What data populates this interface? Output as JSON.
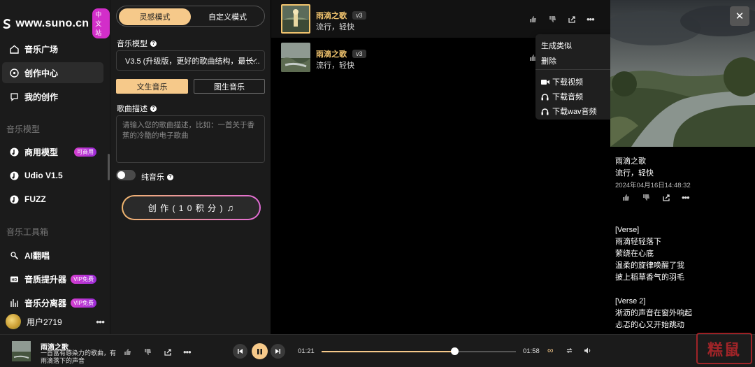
{
  "brand": {
    "name": "www.suno.cn",
    "badge": "中文站"
  },
  "nav": {
    "main": [
      {
        "label": "音乐广场",
        "icon": "home-icon"
      },
      {
        "label": "创作中心",
        "icon": "music-disc-icon"
      },
      {
        "label": "我的创作",
        "icon": "chat-bubble-icon"
      }
    ],
    "section_models": "音乐模型",
    "models": [
      {
        "label": "商用模型",
        "badge": "可商用"
      },
      {
        "label": "Udio V1.5",
        "badge": ""
      },
      {
        "label": "FUZZ",
        "badge": ""
      }
    ],
    "section_tools": "音乐工具箱",
    "tools": [
      {
        "label": "AI翻唱",
        "badge": "",
        "icon": "microphone-icon"
      },
      {
        "label": "音质提升器",
        "badge": "VIP免费",
        "icon": "hd-icon"
      },
      {
        "label": "音乐分离器",
        "badge": "VIP免费",
        "icon": "equalizer-icon"
      }
    ]
  },
  "user": {
    "name": "用户2719"
  },
  "create": {
    "mode_inspiration": "灵感模式",
    "mode_custom": "自定义模式",
    "model_label": "音乐模型",
    "model_value": "V3.5 (升级版，更好的歌曲结构，最长...",
    "tab_text_music": "文生音乐",
    "tab_image_music": "图生音乐",
    "desc_label": "歌曲描述",
    "desc_placeholder": "请输入您的歌曲描述，比如：一首关于香蕉的冷酷的电子歌曲",
    "instrumental_label": "纯音乐",
    "create_button": "创 作 ( 1 0 积 分 )"
  },
  "songs": [
    {
      "title": "雨滴之歌",
      "version": "v3",
      "style": "流行，轻快"
    },
    {
      "title": "雨滴之歌",
      "version": "v3",
      "style": "流行，轻快"
    }
  ],
  "context_menu": {
    "generate_similar": "生成类似",
    "delete": "删除",
    "download_video": "下载视频",
    "download_audio": "下载音频",
    "download_wav": "下载wav音频"
  },
  "detail": {
    "title": "雨滴之歌",
    "style": "流行，轻快",
    "date": "2024年04月16日14:48:32",
    "lyrics": "[Verse]\n雨滴轻轻落下\n萦绕在心底\n温柔的旋律唤醒了我\n披上稻草香气的羽毛\n\n[Verse 2]\n淅沥的声音在窗外响起\n忐忑的心又开始跳动"
  },
  "player": {
    "title": "雨滴之歌",
    "description": "一首富有感染力的歌曲，有雨滴落下的声音",
    "current_time": "01:21",
    "total_time": "01:58",
    "progress_fraction": 0.685
  },
  "watermark_text": "糕鼠",
  "colors": {
    "accent": "#f6c98a",
    "badge_pink": "#d22ec9",
    "panel": "#1b1b1b"
  }
}
